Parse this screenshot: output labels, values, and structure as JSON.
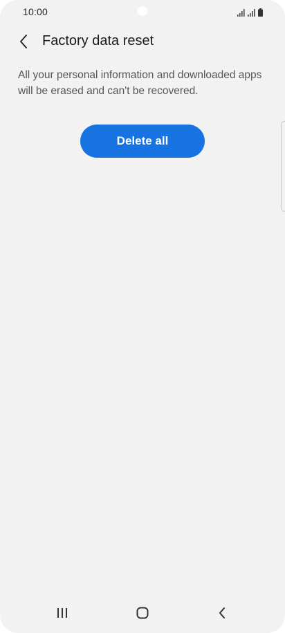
{
  "status_bar": {
    "time": "10:00"
  },
  "header": {
    "title": "Factory data reset",
    "back_icon": "chevron-left-icon"
  },
  "main": {
    "description": "All your personal information and downloaded apps will be erased and can't be recovered.",
    "delete_button_label": "Delete all"
  },
  "nav_bar": {
    "items": [
      "recents-icon",
      "home-icon",
      "back-icon"
    ]
  },
  "colors": {
    "accent": "#1673e1",
    "background": "#f2f2f2",
    "text_primary": "#1a1a1a",
    "text_secondary": "#555555"
  }
}
